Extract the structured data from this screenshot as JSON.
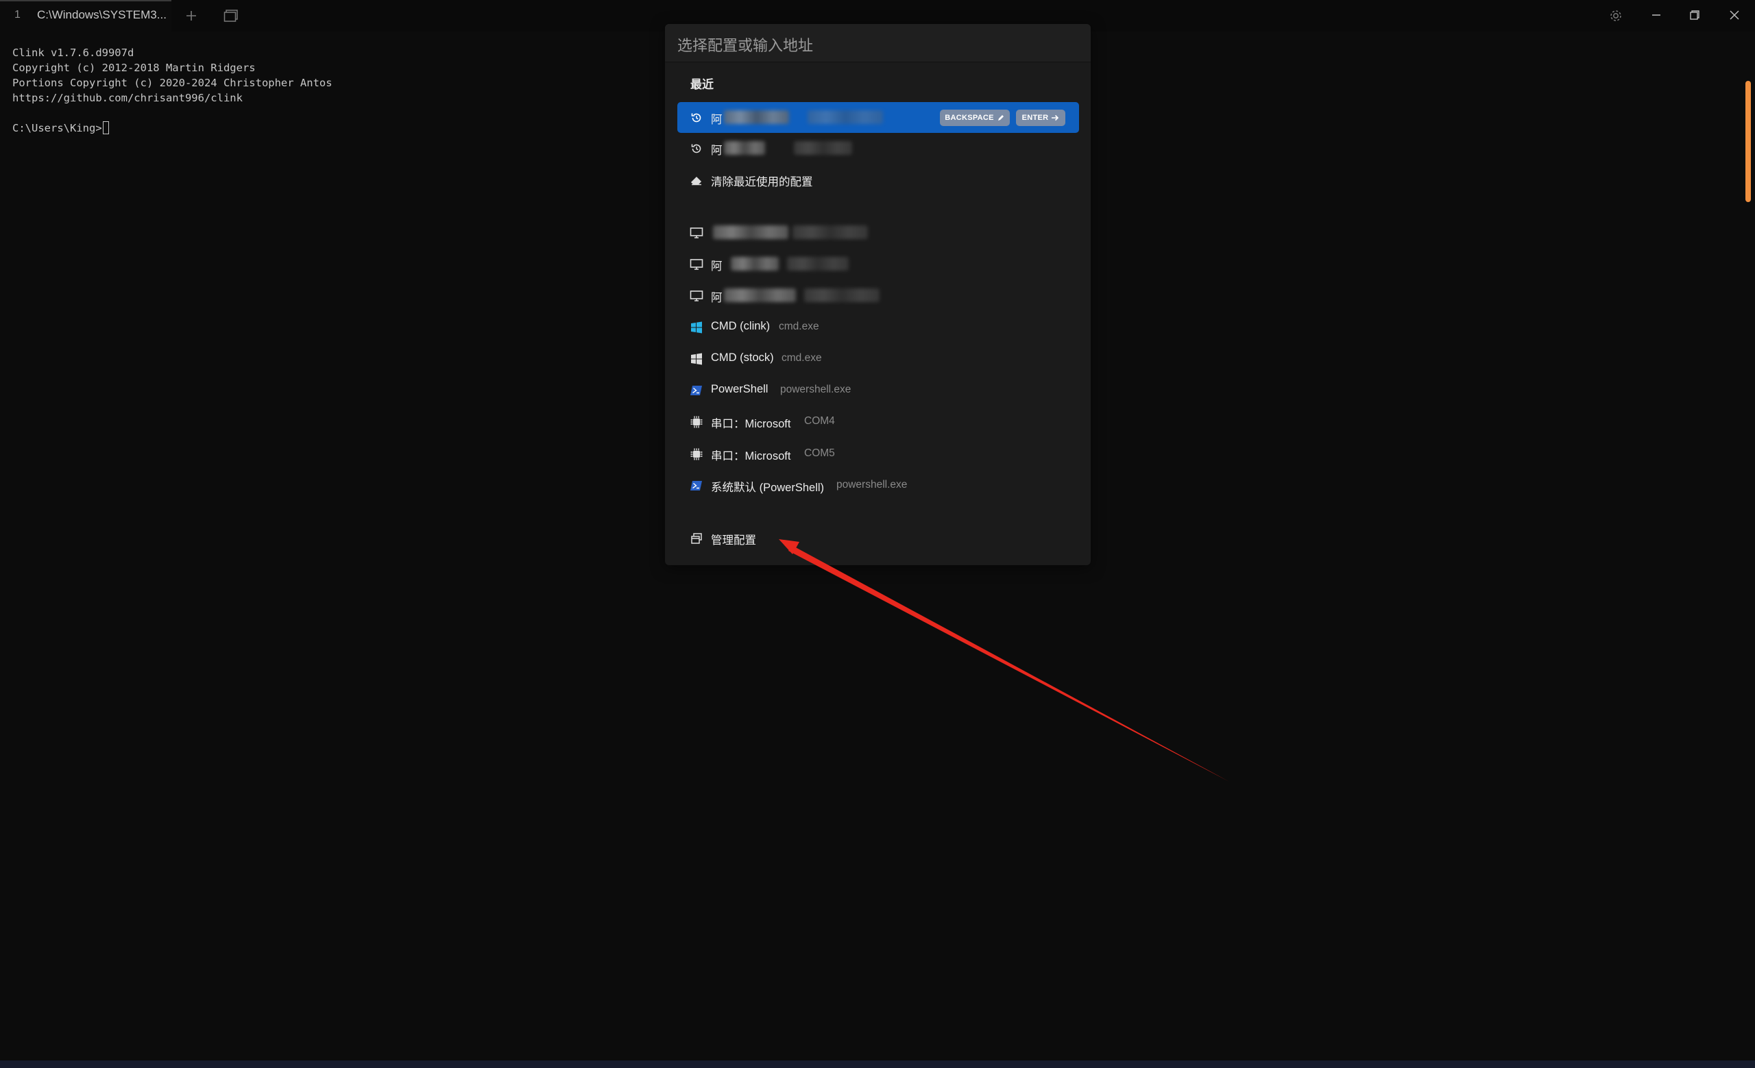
{
  "tab": {
    "index": "1",
    "title": "C:\\Windows\\SYSTEM3..."
  },
  "titlebar_icons": [
    "plus-icon",
    "panes-icon",
    "gear-icon",
    "minimize-icon",
    "maximize-icon",
    "close-icon"
  ],
  "terminal": {
    "lines": [
      "Clink v1.7.6.d9907d",
      "Copyright (c) 2012-2018 Martin Ridgers",
      "Portions Copyright (c) 2020-2024 Christopher Antos",
      "https://github.com/chrisant996/clink",
      "",
      "C:\\Users\\King>"
    ]
  },
  "palette": {
    "placeholder": "选择配置或输入地址",
    "recent_header": "最近",
    "recent_items": [
      {
        "name": "阿",
        "selected": true
      },
      {
        "name": "阿",
        "selected": false
      }
    ],
    "clear_recent": "清除最近使用的配置",
    "profiles": [
      {
        "name": "",
        "sub": "",
        "icon": "monitor-icon"
      },
      {
        "name": "阿",
        "sub": "",
        "icon": "monitor-icon"
      },
      {
        "name": "阿",
        "sub": "",
        "icon": "monitor-icon"
      },
      {
        "name": "CMD (clink)",
        "sub": "cmd.exe",
        "icon": "windows-icon"
      },
      {
        "name": "CMD (stock)",
        "sub": "cmd.exe",
        "icon": "windows-icon"
      },
      {
        "name": "PowerShell",
        "sub": "powershell.exe",
        "icon": "powershell-icon"
      },
      {
        "name": "串口：Microsoft",
        "sub": "COM4",
        "icon": "chip-icon"
      },
      {
        "name": "串口：Microsoft",
        "sub": "COM5",
        "icon": "chip-icon"
      },
      {
        "name": "系统默认 (PowerShell)",
        "sub": "powershell.exe",
        "icon": "powershell-icon"
      }
    ],
    "manage": "管理配置",
    "keys": {
      "backspace": "BACKSPACE",
      "enter": "ENTER"
    }
  },
  "colors": {
    "selection": "#0f5fbe",
    "accent_scrollbar": "#f08f3e",
    "annotation_arrow": "#e8281e"
  }
}
